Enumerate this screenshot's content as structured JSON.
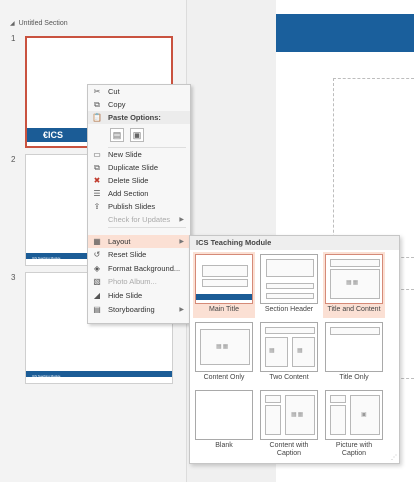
{
  "thumbnail_pane": {
    "section_name": "Untitled Section",
    "slide_numbers": [
      "1",
      "2",
      "3"
    ],
    "slide1_logo_text": "ICS",
    "footer_text": "ICS Teaching Module"
  },
  "context_menu": {
    "items": [
      {
        "label": "Cut",
        "icon": "scissors-icon"
      },
      {
        "label": "Copy",
        "icon": "copy-icon"
      },
      {
        "label": "Paste Options:",
        "icon": "paste-icon"
      },
      {
        "label": "New Slide",
        "icon": "new-slide-icon"
      },
      {
        "label": "Duplicate Slide",
        "icon": "duplicate-slide-icon"
      },
      {
        "label": "Delete Slide",
        "icon": "delete-slide-icon"
      },
      {
        "label": "Add Section",
        "icon": "add-section-icon"
      },
      {
        "label": "Publish Slides",
        "icon": "publish-slides-icon"
      },
      {
        "label": "Check for Updates",
        "icon": "check-updates-icon"
      },
      {
        "label": "Layout",
        "icon": "layout-icon"
      },
      {
        "label": "Reset Slide",
        "icon": "reset-slide-icon"
      },
      {
        "label": "Format Background...",
        "icon": "format-background-icon"
      },
      {
        "label": "Photo Album...",
        "icon": "photo-album-icon"
      },
      {
        "label": "Hide Slide",
        "icon": "hide-slide-icon"
      },
      {
        "label": "Storyboarding",
        "icon": "storyboarding-icon"
      }
    ]
  },
  "layout_gallery": {
    "title": "ICS Teaching Module",
    "layouts": [
      {
        "label": "Main Title"
      },
      {
        "label": "Section Header"
      },
      {
        "label": "Title and Content"
      },
      {
        "label": "Content Only"
      },
      {
        "label": "Two Content"
      },
      {
        "label": "Title Only"
      },
      {
        "label": "Blank"
      },
      {
        "label": "Content with Caption"
      },
      {
        "label": "Picture with Caption"
      }
    ]
  },
  "colors": {
    "accent_blue": "#1b5c96",
    "selection_highlight": "#fbe0d4",
    "selected_border": "#c9523f"
  }
}
